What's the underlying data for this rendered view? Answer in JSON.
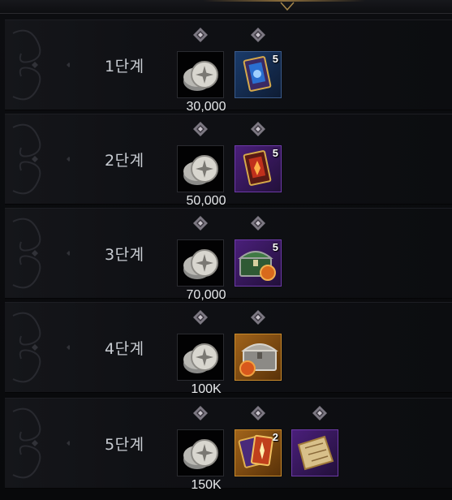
{
  "colors": {
    "background": "#0a0b0d",
    "label": "#c8ccd2",
    "amount": "#e6e8ea",
    "diamond": "#b5b0b8",
    "rare_frame": "#3a5a8a",
    "epic_frame": "#6d3aa8",
    "legendary_frame": "#c98a2a"
  },
  "tiers": [
    {
      "label": "1단계",
      "amount": "30,000",
      "rewards": [
        {
          "icon": "silver-coin-icon",
          "frame": "coin"
        },
        {
          "icon": "blue-card-pack-icon",
          "frame": "blue",
          "quantity": "5"
        }
      ]
    },
    {
      "label": "2단계",
      "amount": "50,000",
      "rewards": [
        {
          "icon": "silver-coin-icon",
          "frame": "coin"
        },
        {
          "icon": "red-card-pack-icon",
          "frame": "purple",
          "quantity": "5"
        }
      ]
    },
    {
      "label": "3단계",
      "amount": "70,000",
      "rewards": [
        {
          "icon": "silver-coin-icon",
          "frame": "coin"
        },
        {
          "icon": "green-treasure-chest-icon",
          "frame": "purple",
          "quantity": "5"
        }
      ]
    },
    {
      "label": "4단계",
      "amount": "100K",
      "rewards": [
        {
          "icon": "silver-coin-icon",
          "frame": "coin"
        },
        {
          "icon": "silver-treasure-chest-icon",
          "frame": "orange"
        }
      ]
    },
    {
      "label": "5단계",
      "amount": "150K",
      "rewards": [
        {
          "icon": "silver-coin-icon",
          "frame": "coin"
        },
        {
          "icon": "legendary-card-pack-icon",
          "frame": "orange",
          "quantity": "2"
        },
        {
          "icon": "map-scroll-icon",
          "frame": "purple"
        }
      ]
    }
  ]
}
